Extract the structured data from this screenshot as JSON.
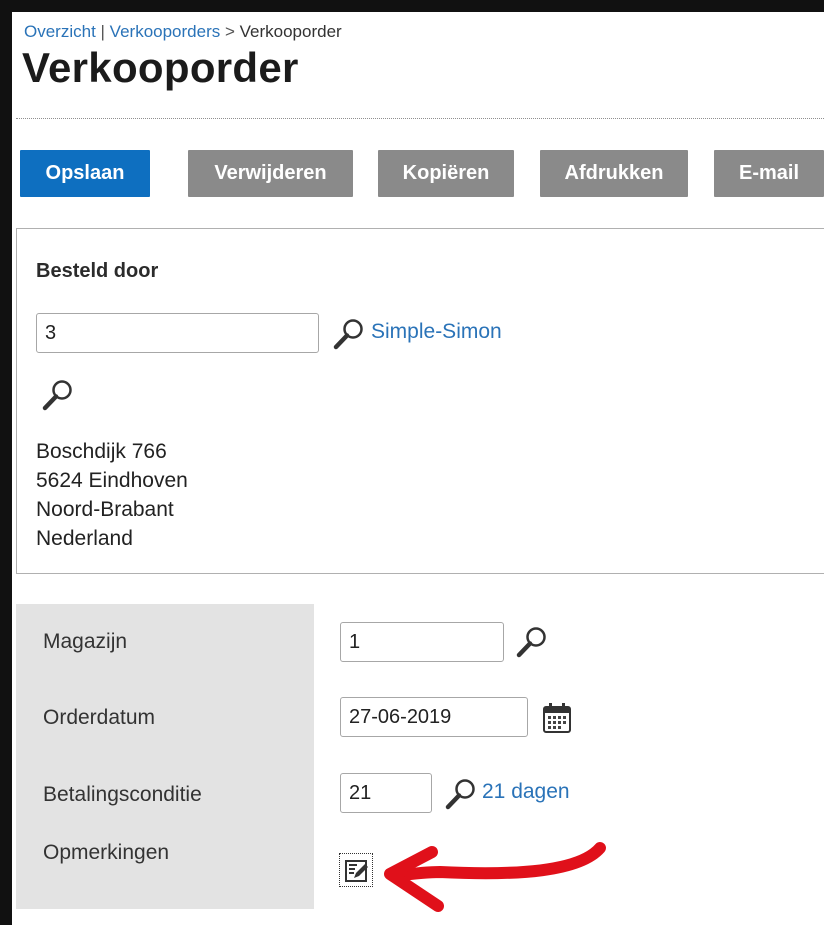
{
  "breadcrumb": {
    "overview": "Overzicht",
    "separator1": " | ",
    "sales_orders": "Verkooporders",
    "separator2": " > ",
    "current": "Verkooporder"
  },
  "page_title": "Verkooporder",
  "toolbar": {
    "save": "Opslaan",
    "delete": "Verwijderen",
    "copy": "Kopiëren",
    "print": "Afdrukken",
    "email": "E-mail"
  },
  "ordered_by": {
    "title": "Besteld door",
    "customer_number": "3",
    "customer_name": "Simple-Simon",
    "address": [
      "Boschdijk 766",
      "5624 Eindhoven",
      "Noord-Brabant",
      "Nederland"
    ]
  },
  "fields": {
    "warehouse_label": "Magazijn",
    "warehouse_value": "1",
    "order_date_label": "Orderdatum",
    "order_date_value": "27-06-2019",
    "payment_term_label": "Betalingsconditie",
    "payment_term_value": "21",
    "payment_term_text": "21 dagen",
    "notes_label": "Opmerkingen"
  },
  "colors": {
    "primary_button": "#0e6fc0",
    "secondary_button": "#8a8a8a",
    "link": "#2a73b8",
    "annotation_arrow": "#e0101a"
  },
  "icons": {
    "lookup": "magnifier-icon",
    "calendar": "calendar-icon",
    "notes": "edit-notes-icon"
  }
}
